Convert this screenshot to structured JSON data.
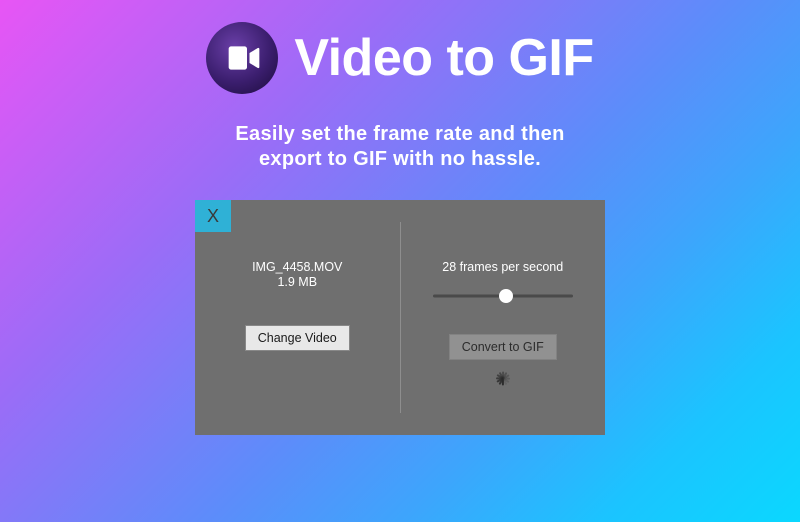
{
  "header": {
    "title": "Video to GIF",
    "icon_name": "videocam-icon"
  },
  "subtitle_line1": "Easily set the frame rate and then",
  "subtitle_line2": "export to GIF with no hassle.",
  "window": {
    "close_label": "X",
    "left": {
      "file_name": "IMG_4458.MOV",
      "file_size": "1.9 MB",
      "change_button": "Change Video"
    },
    "right": {
      "fps_label": "28 frames per second",
      "convert_button": "Convert to GIF"
    }
  },
  "colors": {
    "close_bg": "#2fb1d6",
    "panel_bg": "#6f6f6f"
  }
}
